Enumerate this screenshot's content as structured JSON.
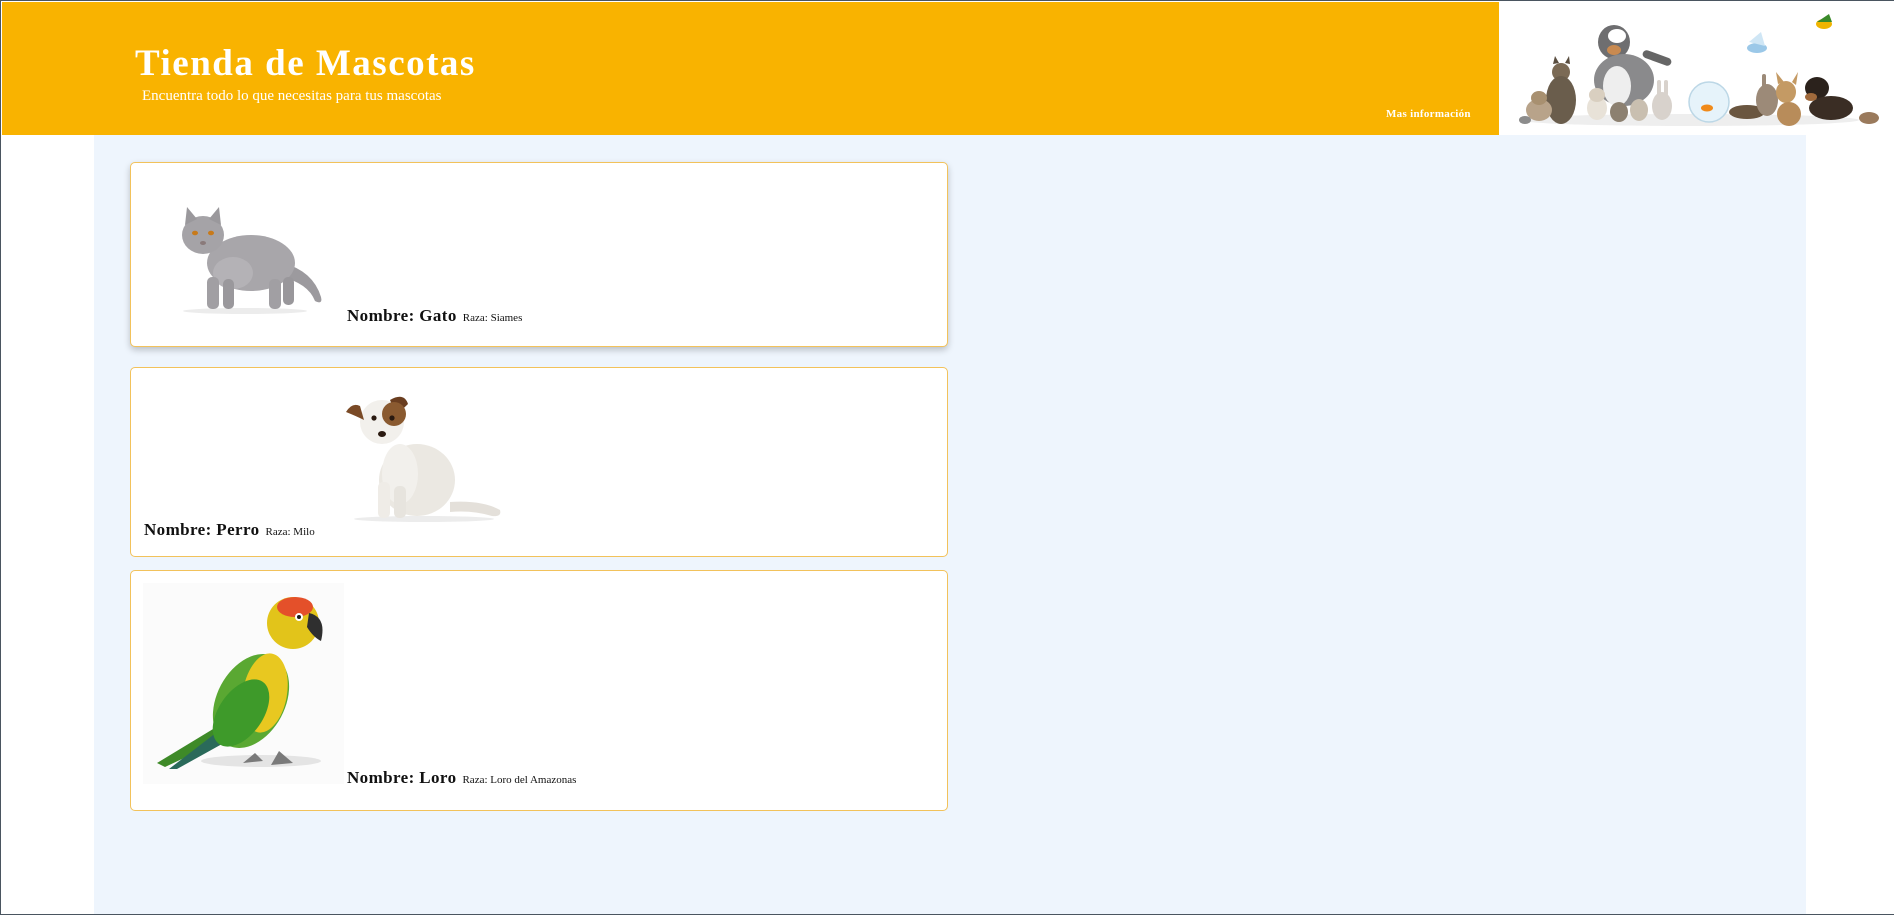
{
  "header": {
    "title": "Tienda de Mascotas",
    "subtitle": "Encuentra todo lo que necesitas para tus mascotas",
    "more_info_link": "Mas información",
    "background_color": "#f9b300",
    "banner_icon": "pets-group-photo"
  },
  "main": {
    "background_color": "#eef5fd",
    "pets": [
      {
        "name_label": "Nombre: Gato",
        "breed_label": "Raza: Siames",
        "image_icon": "gray-cat-photo"
      },
      {
        "name_label": "Nombre: Perro",
        "breed_label": "Raza: Milo",
        "image_icon": "white-dog-photo"
      },
      {
        "name_label": "Nombre: Loro",
        "breed_label": "Raza: Loro del Amazonas",
        "image_icon": "green-parrot-photo"
      }
    ]
  }
}
